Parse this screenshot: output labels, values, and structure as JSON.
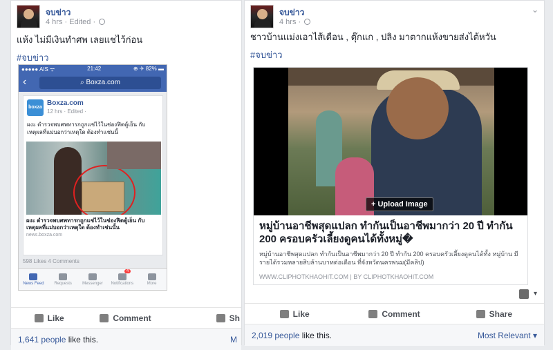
{
  "post1": {
    "author": "จบข่าว",
    "meta": "4 hrs · Edited ·",
    "text": "แห้ง ไม่มีเงินทำศพ เลยแชไว้ก่อน",
    "hashtag": "#จบข่าว",
    "phone": {
      "carrier": "●●●●● AIS ᯤ",
      "time": "21:42",
      "battery": "⊕ ✈ 82% ▬",
      "url": "Boxza.com",
      "post_author": "Boxza.com",
      "post_logo": "boxza",
      "post_meta": "12 hrs · Edited ·",
      "post_text": "ผงะ ตำรวจพบศพทารกถูกแช่ไว้ในช่องฟิตตู้เย็น กับเหตุผลที่แม่บอกว่าเหตุใด ต้องทำแช่นนี้",
      "caption": "ผงะ ตำรวจพบศพทารกถูกแช่ไว้ในช่องฟิตตู้เย็น กับ เหตุผลที่แม่บอกว่าเหตุใด ต้องทำเช่นนั้น",
      "source": "news.boxza.com",
      "stats": "598 Likes   4 Comments",
      "tabs": [
        {
          "label": "News Feed"
        },
        {
          "label": "Requests"
        },
        {
          "label": "Messenger"
        },
        {
          "label": "Notifications",
          "badge": "4"
        },
        {
          "label": "More"
        }
      ]
    },
    "actions": {
      "like": "Like",
      "comment": "Comment",
      "share": "Sh"
    },
    "likes_count": "1,641 people",
    "likes_suffix": " like this.",
    "cut_label": "M"
  },
  "post2": {
    "author": "จบข่าว",
    "meta": "4 hrs ·",
    "text": "ชาวบ้านแม่งเอาไส้เดือน , ตุ๊กแก , ปลิง มาตากแห้งขายส่งไต้หวัน",
    "hashtag": "#จบข่าว",
    "upload_label": "+ Upload Image",
    "link_title": "หมู่บ้านอาชีพสุดแปลก ทำกันเป็นอาชีพมากว่า 20 ปี ทำกัน 200 ครอบครัวเลี้ยงดูคนได้ทั้งหมู่�",
    "link_desc": "หมู่บ้านอาชีพสุดแปลก ทำกันเป็นอาชีพมากว่า 20 ปี ทำกัน 200 ครอบครัวเลี้ยงดูคนได้ทั้ง หมู่บ้าน มีรายได้รวมหลายสิบล้านบาทต่อเดือน ที่จังหวัดนครพนม(มีคลิป)",
    "link_domain": "WWW.CLIPHOTKHAOHIT.COM | BY CLIPHOTKHAOHIT.COM",
    "actions": {
      "like": "Like",
      "comment": "Comment",
      "share": "Share"
    },
    "likes_count": "2,019 people",
    "likes_suffix": " like this.",
    "sort_label": "Most Relevant ▾"
  }
}
